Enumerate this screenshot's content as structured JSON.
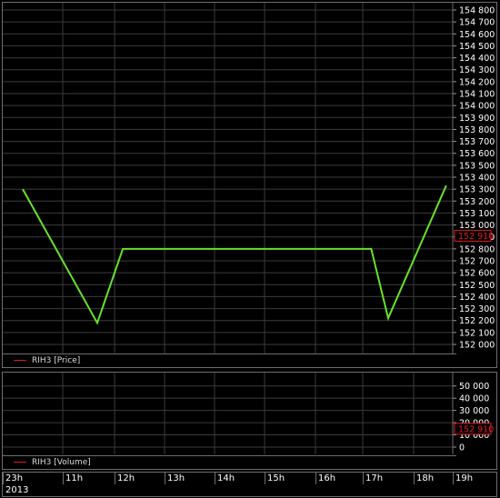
{
  "chart_data": [
    {
      "type": "bar",
      "title": "",
      "series": [
        {
          "name": "RIH3 [Price]",
          "color": "#e11b22"
        }
      ],
      "trendline_color": "#66e22a",
      "ylim": [
        152000,
        154800
      ],
      "yticks": [
        "154 800",
        "154 700",
        "154 600",
        "154 500",
        "154 400",
        "154 300",
        "154 200",
        "154 100",
        "154 000",
        "153 900",
        "153 800",
        "153 700",
        "153 600",
        "153 500",
        "153 400",
        "153 300",
        "153 200",
        "153 100",
        "153 000",
        "152 900",
        "152 800",
        "152 700",
        "152 600",
        "152 500",
        "152 400",
        "152 300",
        "152 200",
        "152 100",
        "152 000"
      ],
      "last_value": "152 910",
      "trendline_points": [
        {
          "x": "10h20",
          "y": 153300
        },
        {
          "x": "11h40",
          "y": 152180
        },
        {
          "x": "12h10",
          "y": 152800
        },
        {
          "x": "17h10",
          "y": 152800
        },
        {
          "x": "17h30",
          "y": 152220
        },
        {
          "x": "18h50",
          "y": 153330
        }
      ],
      "grid": true
    },
    {
      "type": "bar",
      "title": "",
      "series": [
        {
          "name": "RIH3 [Volume]",
          "color": "#e11b22"
        }
      ],
      "ylim": [
        0,
        55000
      ],
      "yticks": [
        "50 000",
        "40 000",
        "30 000",
        "20 000",
        "10 000",
        "0"
      ],
      "last_value": "152 910",
      "grid": true
    }
  ],
  "time_axis": {
    "ticks": [
      "23h",
      "11h",
      "12h",
      "13h",
      "14h",
      "15h",
      "16h",
      "17h",
      "18h",
      "19h"
    ],
    "year": "2013"
  },
  "legend": {
    "price": "RIH3 [Price]",
    "volume": "RIH3 [Volume]"
  }
}
